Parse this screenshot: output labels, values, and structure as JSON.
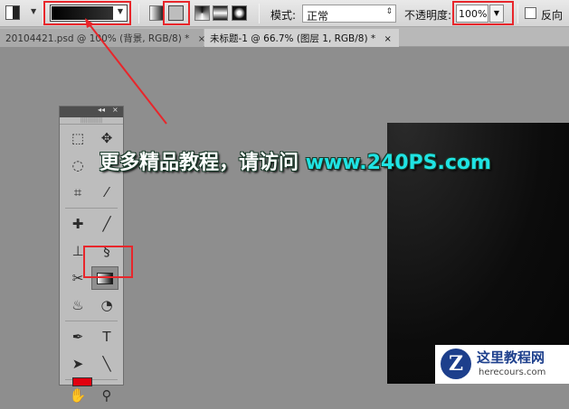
{
  "options_bar": {
    "tool_preset_icon": "gradient-tool-preset-icon",
    "gradient_picker": {
      "colors": [
        "#000000",
        "#333333"
      ]
    },
    "gradient_types": [
      {
        "name": "linear",
        "active": false
      },
      {
        "name": "radial",
        "active": true
      },
      {
        "name": "angle",
        "active": false
      },
      {
        "name": "reflected",
        "active": false
      },
      {
        "name": "diamond",
        "active": false
      }
    ],
    "mode_label": "模式:",
    "mode_value": "正常",
    "opacity_label": "不透明度:",
    "opacity_value": "100%",
    "reverse_label": "反向"
  },
  "tabs": [
    {
      "label": "20104421.psd @ 100% (背景, RGB/8) *",
      "close": "×"
    },
    {
      "label": "未标题-1 @ 66.7% (图层 1, RGB/8) *",
      "close": "×"
    }
  ],
  "toolbox": {
    "head_left": "◂◂",
    "head_right": "×",
    "grip": "||||||||||||",
    "tools": [
      {
        "left": "marquee-icon",
        "right": "move-icon"
      },
      {
        "left": "lasso-icon",
        "right": "quick-select-icon"
      },
      {
        "left": "crop-icon",
        "right": "eyedropper-icon"
      },
      {
        "left": "healing-brush-icon",
        "right": "brush-icon"
      },
      {
        "left": "clone-stamp-icon",
        "right": "history-brush-icon"
      },
      {
        "left": "eraser-icon",
        "right": "gradient-icon"
      },
      {
        "left": "blur-icon",
        "right": "dodge-icon"
      },
      {
        "left": "pen-icon",
        "right": "type-icon"
      },
      {
        "left": "path-select-icon",
        "right": "line-icon"
      },
      {
        "left": "hand-icon",
        "right": "zoom-icon"
      }
    ],
    "glyphs": {
      "marquee": "⬚",
      "move": "✥",
      "lasso": "◌",
      "quick_select": "⌖",
      "crop": "⌗",
      "eyedropper": "⁄",
      "healing": "✚",
      "brush": "╱",
      "stamp": "⊥",
      "history": "§",
      "eraser": "✂",
      "blur": "♨",
      "dodge": "◔",
      "pen": "✒",
      "type": "T",
      "path_select": "➤",
      "line": "╲",
      "hand": "✋",
      "zoom": "⚲"
    },
    "foreground_color": "#e2000f"
  },
  "promo": {
    "text": "更多精品教程，请访问 ",
    "url": "www.240PS.com"
  },
  "watermark": {
    "logo": "Z",
    "title": "这里教程网",
    "url": "herecours.com"
  },
  "colors": {
    "highlight": "#e8262b",
    "promo_url": "#1fe3e3",
    "canvas": "#0c0c0c"
  }
}
